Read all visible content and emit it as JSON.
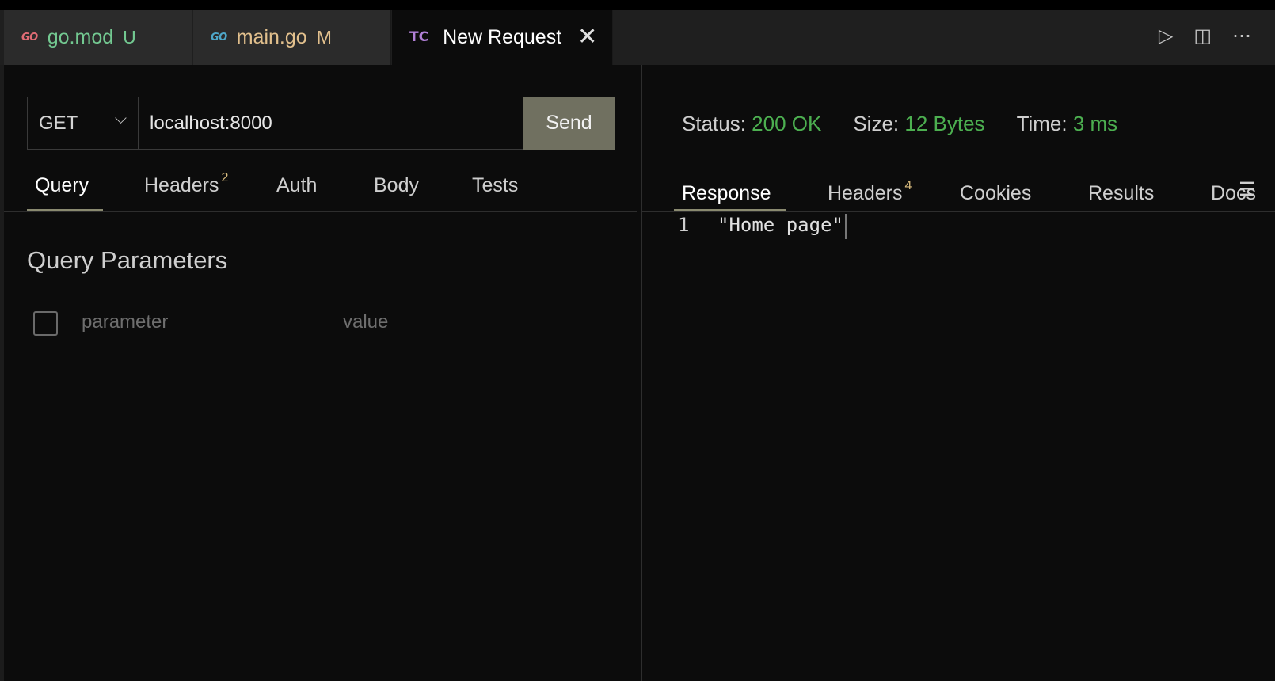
{
  "tabs": [
    {
      "icon": "GO",
      "name": "go.mod",
      "badge": "U",
      "name_color": "#73c991",
      "badge_color": "#73c991",
      "icon_color": "#e06c75"
    },
    {
      "icon": "GO",
      "name": "main.go",
      "badge": "M",
      "name_color": "#e2c08d",
      "badge_color": "#e2c08d",
      "icon_color": "#4ea7c9"
    },
    {
      "icon": "TC",
      "name": "New Request",
      "close": "✕",
      "name_color": "#ffffff"
    }
  ],
  "editor_actions": {
    "run": "▷",
    "split": "◫",
    "more": "⋯"
  },
  "request": {
    "method": "GET",
    "method_chevron": "⌵",
    "url": "localhost:8000",
    "send_label": "Send"
  },
  "request_tabs": {
    "query": "Query",
    "headers": "Headers",
    "headers_count": "2",
    "auth": "Auth",
    "body": "Body",
    "tests": "Tests",
    "active": "Query"
  },
  "query_params": {
    "title": "Query Parameters",
    "parameter_placeholder": "parameter",
    "value_placeholder": "value"
  },
  "response_status": {
    "status_label": "Status:",
    "status_value": "200 OK",
    "size_label": "Size:",
    "size_value": "12 Bytes",
    "time_label": "Time:",
    "time_value": "3 ms",
    "value_color": "#4caf50"
  },
  "response_tabs": {
    "response": "Response",
    "headers": "Headers",
    "headers_count": "4",
    "cookies": "Cookies",
    "results": "Results",
    "docs": "Docs",
    "active": "Response"
  },
  "response_body": {
    "line_number": "1",
    "content": "\"Home page\""
  }
}
